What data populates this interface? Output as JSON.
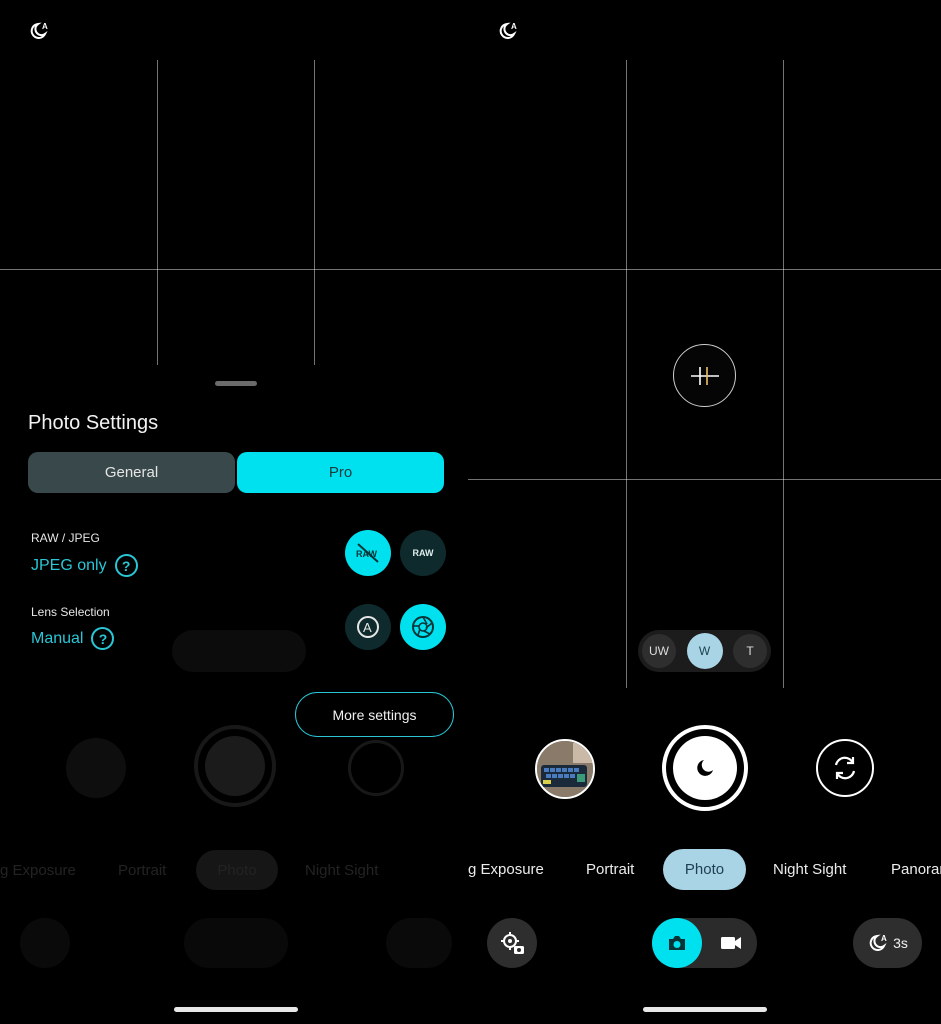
{
  "left": {
    "night_auto_icon": "moon-auto-icon",
    "sheet": {
      "title": "Photo Settings",
      "tabs": [
        {
          "label": "General"
        },
        {
          "label": "Pro"
        }
      ],
      "raw_jpeg": {
        "label": "RAW / JPEG",
        "value": "JPEG only",
        "help": "?",
        "raw_button": "RAW"
      },
      "lens": {
        "label": "Lens Selection",
        "value": "Manual",
        "help": "?"
      },
      "more_settings": "More settings"
    },
    "bg_modes": [
      "g Exposure",
      "Portrait",
      "Photo",
      "Night Sight"
    ]
  },
  "right": {
    "night_auto_icon": "moon-auto-icon",
    "zoom": [
      {
        "label": "UW"
      },
      {
        "label": "W"
      },
      {
        "label": "T"
      }
    ],
    "modes": [
      "g Exposure",
      "Portrait",
      "Photo",
      "Night Sight",
      "Panorar"
    ],
    "night_timer": "3s"
  }
}
